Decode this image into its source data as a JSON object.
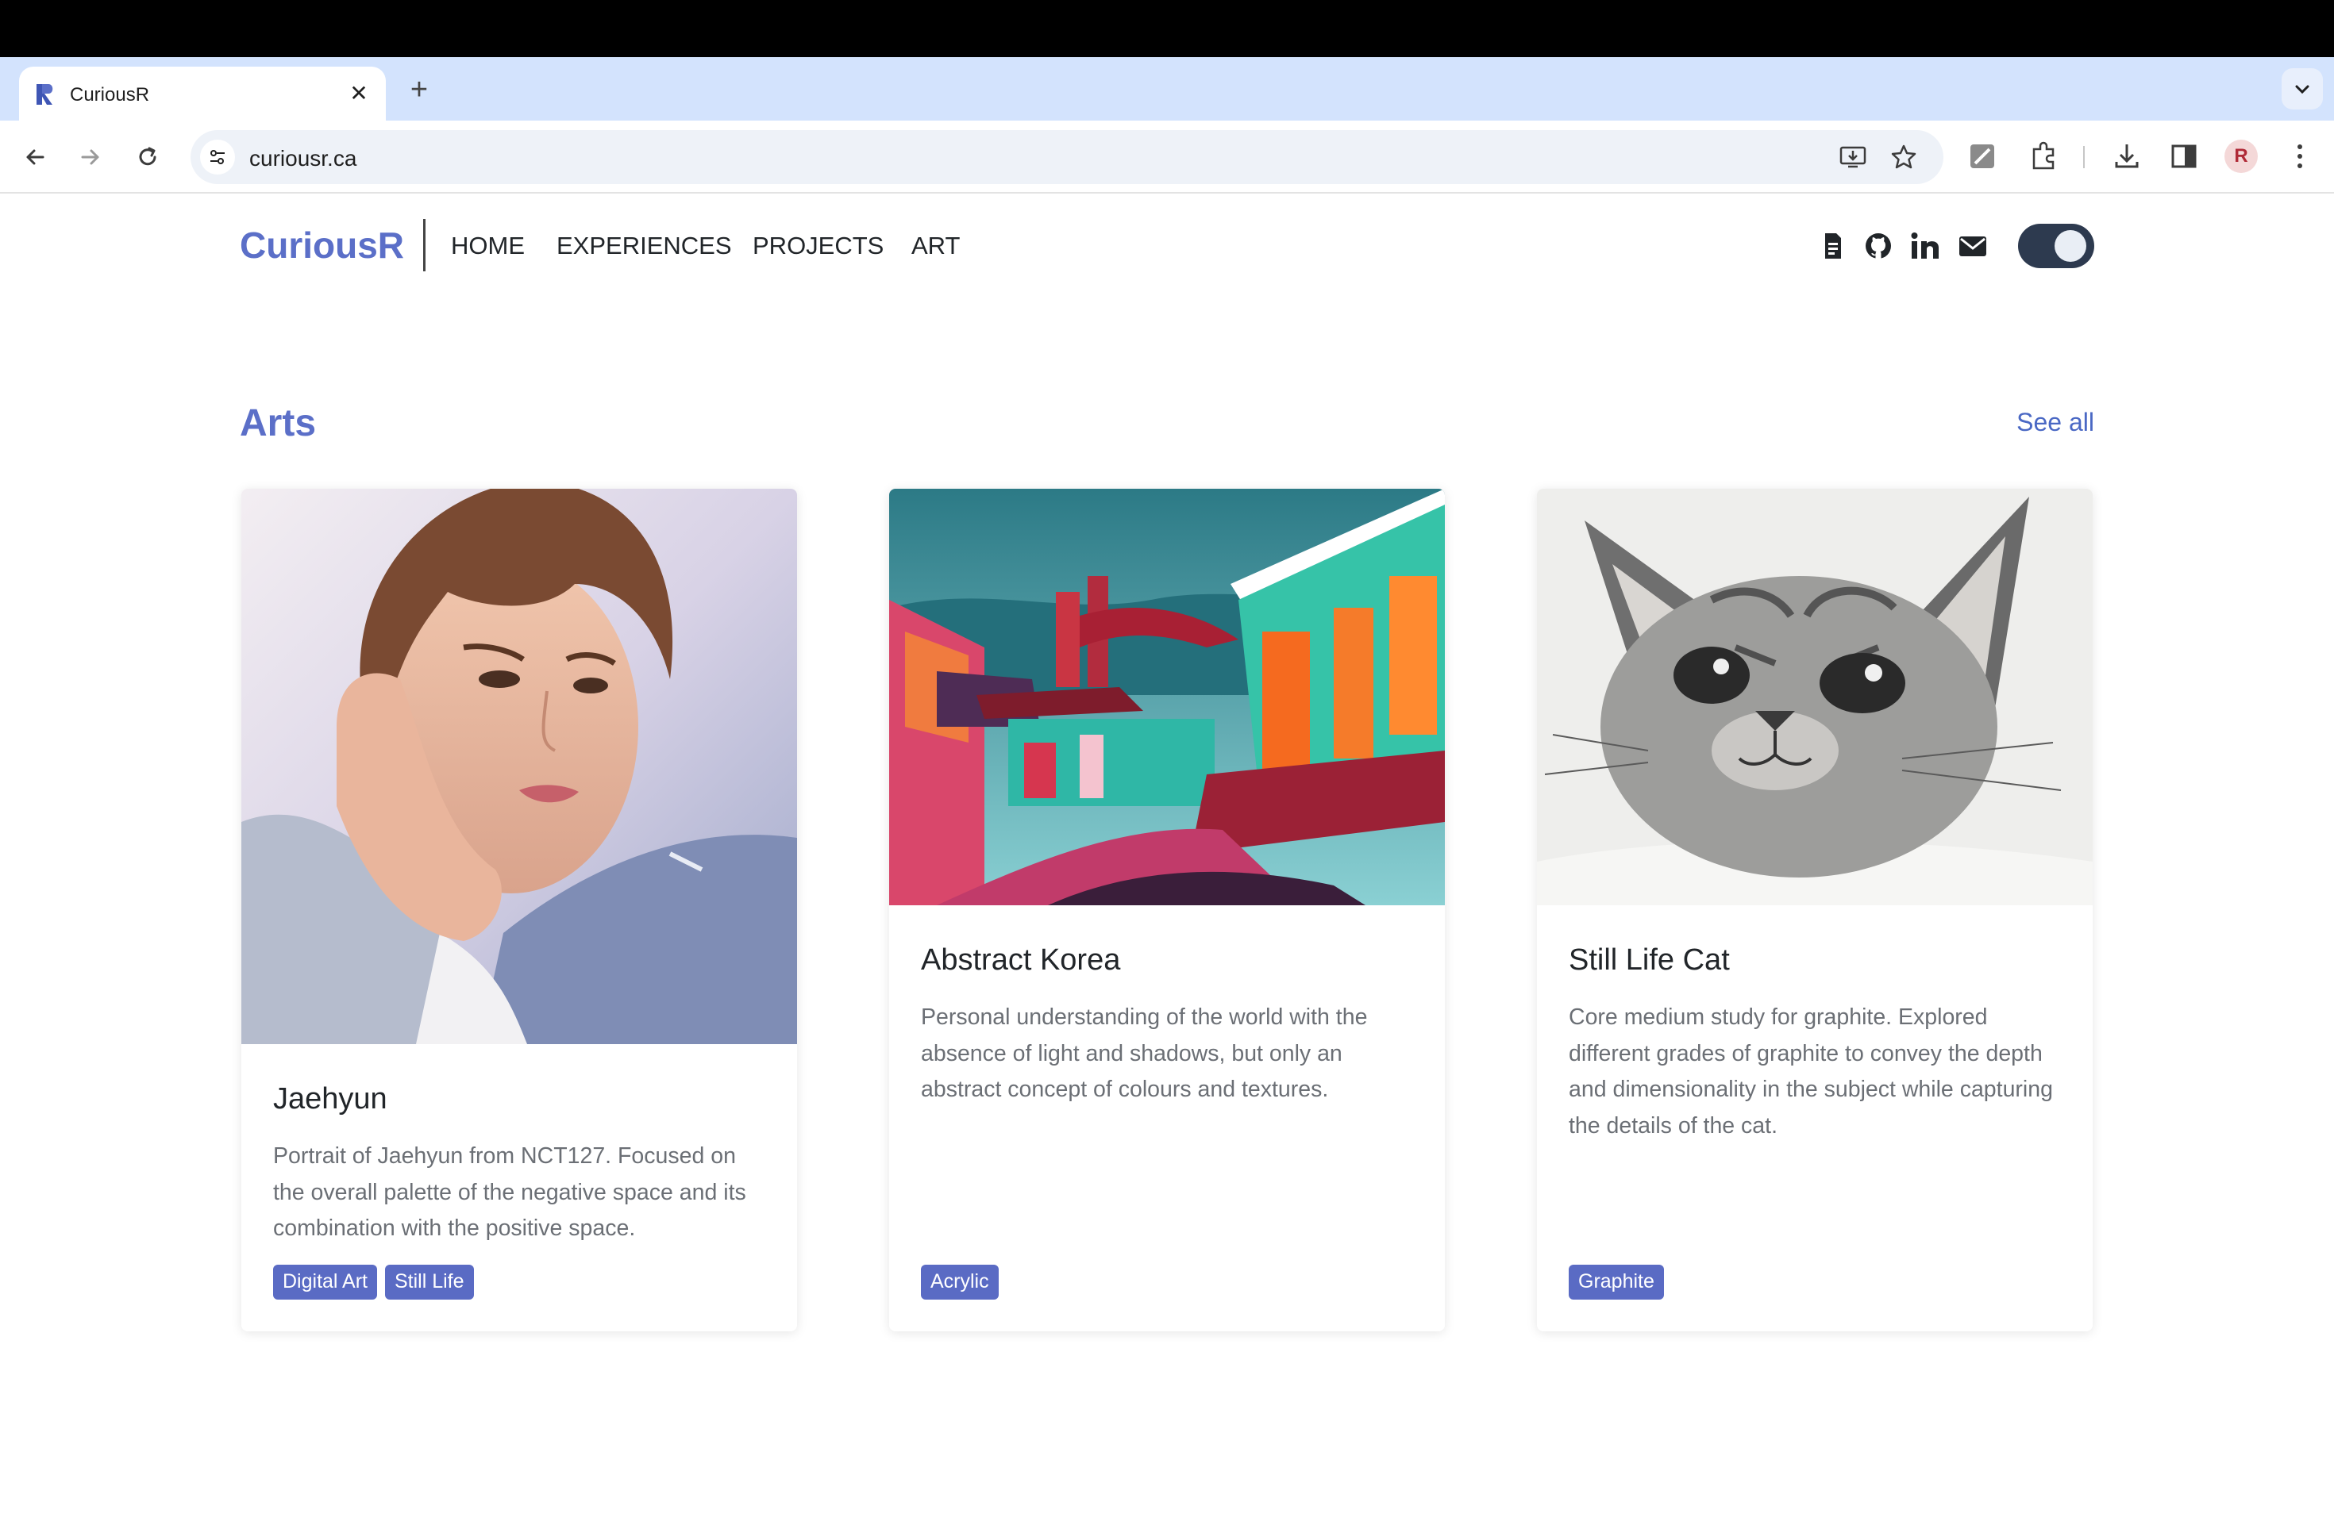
{
  "browser": {
    "tab_title": "CuriousR",
    "tab_close": "✕",
    "new_tab": "+",
    "url": "curiousr.ca"
  },
  "nav": {
    "brand": "CuriousR",
    "links": [
      "HOME",
      "EXPERIENCES",
      "PROJECTS",
      "ART"
    ],
    "icons": [
      "resume-icon",
      "github-icon",
      "linkedin-icon",
      "mail-icon"
    ],
    "dark_mode": true
  },
  "section": {
    "title": "Arts",
    "see_all": "See all"
  },
  "cards": [
    {
      "title": "Jaehyun",
      "text": "Portrait of Jaehyun from NCT127. Focused on the overall palette of the negative space and its combination with the positive space.",
      "tags": [
        "Digital Art",
        "Still Life"
      ]
    },
    {
      "title": "Abstract Korea",
      "text": "Personal understanding of the world with the absence of light and shadows, but only an abstract concept of colours and textures.",
      "tags": [
        "Acrylic"
      ]
    },
    {
      "title": "Still Life Cat",
      "text": "Core medium study for graphite. Explored different grades of graphite to convey the depth and dimensionality in the subject while capturing the details of the cat.",
      "tags": [
        "Graphite"
      ]
    }
  ],
  "colors": {
    "brand": "#5b6fc8",
    "badge": "#5a6bc4",
    "tab_strip": "#d3e3fd"
  }
}
